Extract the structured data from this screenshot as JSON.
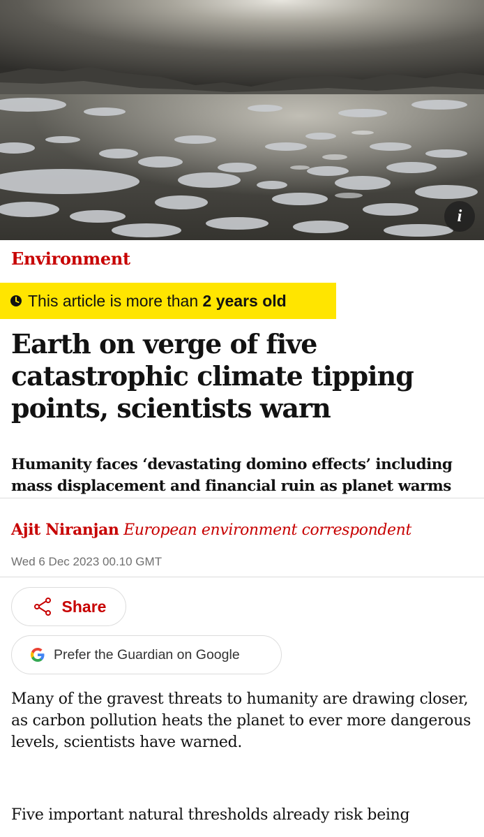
{
  "hero": {
    "info_label": "i"
  },
  "section": {
    "label": "Environment"
  },
  "age_warning": {
    "prefix": "This article is more than ",
    "emphasis": "2 years old",
    "background": "#ffe500"
  },
  "headline": "Earth on verge of five catastrophic climate tipping points, scientists warn",
  "standfirst": "Humanity faces ‘devastating domino effects’ including mass displacement and financial ruin as planet warms",
  "byline": {
    "author": "Ajit Niranjan",
    "role": "European environment correspondent",
    "date": "Wed 6 Dec 2023 00.10 GMT"
  },
  "actions": {
    "share_label": "Share",
    "google_label": "Prefer the Guardian on Google"
  },
  "body": {
    "paragraphs": [
      "Many of the gravest threats to humanity are drawing closer, as carbon pollution heats the planet to ever more dangerous levels, scientists have warned.",
      "Five important natural thresholds already risk being"
    ]
  },
  "colors": {
    "accent_red": "#c70000",
    "text": "#121212",
    "muted": "#707070",
    "rule": "#dcdcdc"
  },
  "icons": {
    "clock": "clock-icon",
    "share": "share-icon",
    "google": "google-icon",
    "info": "info-icon"
  }
}
